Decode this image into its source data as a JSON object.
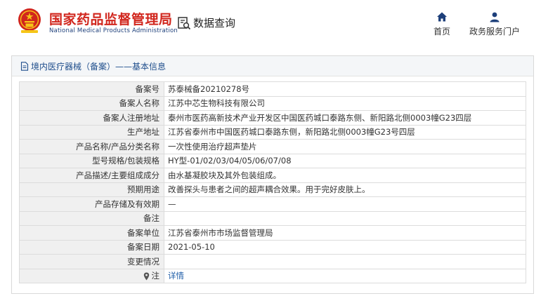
{
  "header": {
    "brand_cn": "国家药品监督管理局",
    "brand_en": "National Medical Products Administration",
    "query_label": "数据查询",
    "nav": {
      "home": "首页",
      "service": "政务服务门户"
    }
  },
  "panel": {
    "title": "境内医疗器械（备案）——基本信息"
  },
  "rows": [
    {
      "label": "备案号",
      "value": "苏泰械备20210278号"
    },
    {
      "label": "备案人名称",
      "value": "江苏中芯生物科技有限公司"
    },
    {
      "label": "备案人注册地址",
      "value": "泰州市医药高新技术产业开发区中国医药城口泰路东侧、新阳路北侧0003幢G23四层"
    },
    {
      "label": "生产地址",
      "value": "江苏省泰州市中国医药城口泰路东侧，新阳路北侧0003幢G23号四层"
    },
    {
      "label": "产品名称/产品分类名称",
      "value": "一次性使用治疗超声垫片"
    },
    {
      "label": "型号规格/包装规格",
      "value": "HY型-01/02/03/04/05/06/07/08"
    },
    {
      "label": "产品描述/主要组成成分",
      "value": "由水基凝胶块及其外包装组成。"
    },
    {
      "label": "预期用途",
      "value": "改善探头与患者之间的超声耦合效果。用于完好皮肤上。"
    },
    {
      "label": "产品存储及有效期",
      "value": "—"
    },
    {
      "label": "备注",
      "value": ""
    },
    {
      "label": "备案单位",
      "value": "江苏省泰州市市场监督管理局"
    },
    {
      "label": "备案日期",
      "value": "2021-05-10"
    },
    {
      "label": "变更情况",
      "value": ""
    },
    {
      "label": "注",
      "value": "详情"
    }
  ],
  "colors": {
    "brand_red": "#d1261d",
    "brand_blue": "#1d3f7a",
    "link_blue": "#1f5ea8",
    "label_bg": "#f0f0f0"
  },
  "icons": {
    "logo": "national-emblem-icon",
    "query": "search-document-icon",
    "home": "home-icon",
    "service": "user-icon",
    "panel": "document-icon",
    "note": "pin-icon"
  }
}
